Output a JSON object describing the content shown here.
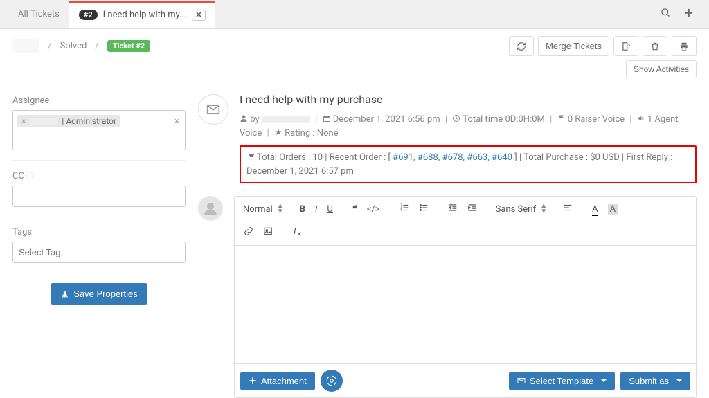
{
  "tabs": {
    "all_tickets": "All Tickets",
    "active_badge": "#2",
    "active_label": "I need help with my..."
  },
  "breadcrumb": {
    "solved": "Solved",
    "ticket_badge": "Ticket #2"
  },
  "toolbar": {
    "merge": "Merge Tickets",
    "show_activities": "Show Activities"
  },
  "sidebar": {
    "assignee_label": "Assignee",
    "assignee_chip": " | Administrator",
    "cc_label": "CC",
    "tags_label": "Tags",
    "tags_placeholder": "Select Tag",
    "save_btn": "Save Properties"
  },
  "ticket": {
    "title": "I need help with my purchase",
    "by_label": "by",
    "date": "December 1, 2021 6:56 pm",
    "total_time_label": "Total time",
    "total_time_value": "0D:0H:0M",
    "raiser_voice": "0 Raiser Voice",
    "agent_voice": "1 Agent Voice",
    "rating_label": "Rating",
    "rating_value": ": None"
  },
  "orders": {
    "total_orders_label": "Total Orders :",
    "total_orders_value": "10",
    "recent_label": "Recent Order :",
    "links": [
      "#691",
      "#688",
      "#678",
      "#663",
      "#640"
    ],
    "total_purchase_label": "Total Purchase :",
    "total_purchase_value": "$0 USD",
    "first_reply_label": "First Reply :",
    "first_reply_value": "December 1, 2021 6:57 pm"
  },
  "editor": {
    "normal": "Normal",
    "sans_serif": "Sans Serif",
    "attachment": "Attachment",
    "select_template": "Select Template",
    "submit_as": "Submit as"
  }
}
